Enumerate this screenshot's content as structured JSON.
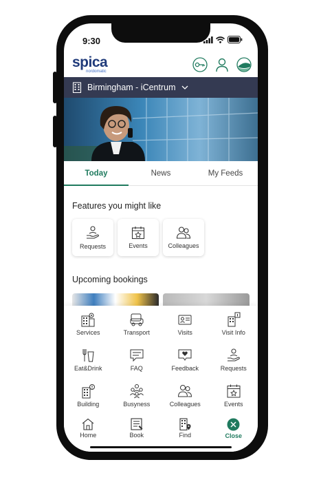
{
  "status": {
    "time": "9:30"
  },
  "header": {
    "logo_main": "spica",
    "logo_sub": "nordomatic"
  },
  "location": {
    "label": "Birmingham - iCentrum"
  },
  "tabs": [
    {
      "label": "Today",
      "active": true
    },
    {
      "label": "News",
      "active": false
    },
    {
      "label": "My Feeds",
      "active": false
    }
  ],
  "features": {
    "title": "Features you might like",
    "items": [
      {
        "label": "Requests",
        "icon": "hand-person-icon"
      },
      {
        "label": "Events",
        "icon": "calendar-star-icon"
      },
      {
        "label": "Colleagues",
        "icon": "people-icon"
      }
    ]
  },
  "bookings": {
    "title": "Upcoming bookings"
  },
  "menu": {
    "items": [
      {
        "label": "Services",
        "icon": "building-gear-icon"
      },
      {
        "label": "Transport",
        "icon": "car-icon"
      },
      {
        "label": "Visits",
        "icon": "id-card-icon"
      },
      {
        "label": "Visit Info",
        "icon": "building-info-icon"
      },
      {
        "label": "Eat&Drink",
        "icon": "cutlery-cup-icon"
      },
      {
        "label": "FAQ",
        "icon": "chat-lines-icon"
      },
      {
        "label": "Feedback",
        "icon": "chat-heart-icon"
      },
      {
        "label": "Requests",
        "icon": "hand-person-icon"
      },
      {
        "label": "Building",
        "icon": "building-alert-icon"
      },
      {
        "label": "Busyness",
        "icon": "crowd-icon"
      },
      {
        "label": "Colleagues",
        "icon": "people-icon"
      },
      {
        "label": "Events",
        "icon": "calendar-star-icon"
      }
    ]
  },
  "nav": [
    {
      "label": "Home",
      "icon": "home-icon"
    },
    {
      "label": "Book",
      "icon": "book-icon"
    },
    {
      "label": "Find",
      "icon": "building-pin-icon"
    },
    {
      "label": "Close",
      "icon": "close-circle-icon"
    }
  ],
  "colors": {
    "accent": "#1f7a5e",
    "brand": "#1f3a7a",
    "location_bar": "#343a52"
  }
}
